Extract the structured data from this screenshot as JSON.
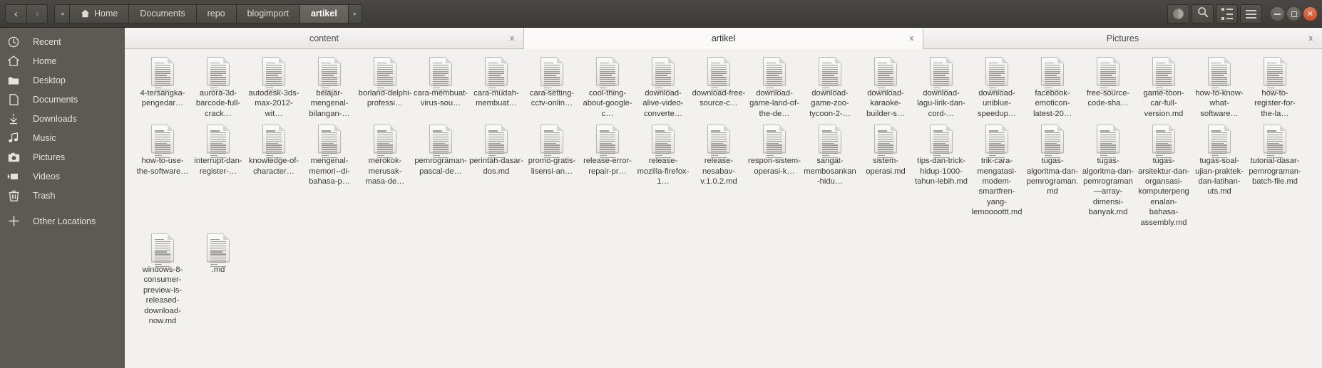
{
  "window": {
    "nav": {
      "back": "‹",
      "forward": "›"
    },
    "breadcrumbs": [
      {
        "label": "Home",
        "icon": "home-icon",
        "current": false
      },
      {
        "label": "Documents",
        "icon": "",
        "current": false
      },
      {
        "label": "repo",
        "icon": "",
        "current": false
      },
      {
        "label": "blogimport",
        "icon": "",
        "current": false
      },
      {
        "label": "artikel",
        "icon": "",
        "current": true
      }
    ],
    "path_collapse": "◂",
    "path_more": "▸",
    "toolbar": [
      {
        "name": "progress-pie-icon",
        "label": ""
      },
      {
        "name": "search-icon",
        "label": ""
      },
      {
        "name": "view-list-icon",
        "label": ""
      },
      {
        "name": "menu-icon",
        "label": ""
      }
    ],
    "window_controls": [
      {
        "name": "minimize-button",
        "glyph": "–"
      },
      {
        "name": "maximize-button",
        "glyph": "▢"
      },
      {
        "name": "close-button",
        "glyph": "✕"
      }
    ]
  },
  "sidebar": {
    "items": [
      {
        "label": "Recent",
        "icon": "clock-icon"
      },
      {
        "label": "Home",
        "icon": "home-icon"
      },
      {
        "label": "Desktop",
        "icon": "folder-icon"
      },
      {
        "label": "Documents",
        "icon": "document-icon"
      },
      {
        "label": "Downloads",
        "icon": "download-arrow-icon"
      },
      {
        "label": "Music",
        "icon": "music-note-icon"
      },
      {
        "label": "Pictures",
        "icon": "camera-icon"
      },
      {
        "label": "Videos",
        "icon": "video-camera-icon"
      },
      {
        "label": "Trash",
        "icon": "trash-icon"
      },
      {
        "label": "Other Locations",
        "icon": "plus-icon"
      }
    ]
  },
  "tabs": [
    {
      "label": "content",
      "active": false,
      "close": "x"
    },
    {
      "label": "artikel",
      "active": true,
      "close": "x"
    },
    {
      "label": "Pictures",
      "active": false,
      "close": "x"
    }
  ],
  "files": [
    {
      "name": "4-tersangka-pengedar…"
    },
    {
      "name": "aurora-3d-barcode-full-crack…"
    },
    {
      "name": "autodesk-3ds-max-2012-wit…"
    },
    {
      "name": "belajar-mengenal-bilangan-…"
    },
    {
      "name": "borland-delphi-professi…"
    },
    {
      "name": "cara-membuat-virus-sou…"
    },
    {
      "name": "cara-mudah-membuat…"
    },
    {
      "name": "cara-setting-cctv-onlin…"
    },
    {
      "name": "cool-thing-about-google-c…"
    },
    {
      "name": "download-alive-video-converte…"
    },
    {
      "name": "download-free-source-c…"
    },
    {
      "name": "download-game-land-of-the-de…"
    },
    {
      "name": "download-game-zoo-tycoon-2-…"
    },
    {
      "name": "download-karaoke-builder-s…"
    },
    {
      "name": "download-lagu-lirik-dan-cord-…"
    },
    {
      "name": "download-uniblue-speedup…"
    },
    {
      "name": "facebook-emoticon-latest-20…"
    },
    {
      "name": "free-source-code-sha…"
    },
    {
      "name": "game-toon-car-full-version.md"
    },
    {
      "name": "how-to-know-what-software…"
    },
    {
      "name": "how-to-register-for-the-la…"
    },
    {
      "name": "how-to-use-the-software…"
    },
    {
      "name": "interrupt-dan-register-…"
    },
    {
      "name": "knowledge-of-character…"
    },
    {
      "name": "mengenal-memori--di-bahasa-p…"
    },
    {
      "name": "merokok-merusak-masa-de…"
    },
    {
      "name": "pemrograman-pascal-de…"
    },
    {
      "name": "perintah-dasar-dos.md"
    },
    {
      "name": "promo-gratis-lisensi-an…"
    },
    {
      "name": "release-error-repair-pr…"
    },
    {
      "name": "release-mozilla-firefox-1…"
    },
    {
      "name": "release-nesabav-v.1.0.2.md"
    },
    {
      "name": "respon-sistem-operasi-k…"
    },
    {
      "name": "sangat-membosankan-hidu…"
    },
    {
      "name": "sistem-operasi.md"
    },
    {
      "name": "tips-dan-trick-hidup-1000-tahun-lebih.md"
    },
    {
      "name": "trik-cara-mengatasi-modem-smartfren-yang-lemoooottt.md"
    },
    {
      "name": "tugas-algoritma-dan-pemrograman.md"
    },
    {
      "name": "tugas-algoritma-dan-pemrograman—array-dimensi-banyak.md"
    },
    {
      "name": "tugas-arsitektur-dan-organsasi-komputerpengenalan-bahasa-assembly.md"
    },
    {
      "name": "tugas-soal-ujian-praktek-dan-latihan-uts.md"
    },
    {
      "name": "tutorial-dasar-pemrograman-batch-file.md"
    },
    {
      "name": "windows-8-consumer-preview-is-released-download-now.md"
    },
    {
      "name": ".md"
    }
  ]
}
